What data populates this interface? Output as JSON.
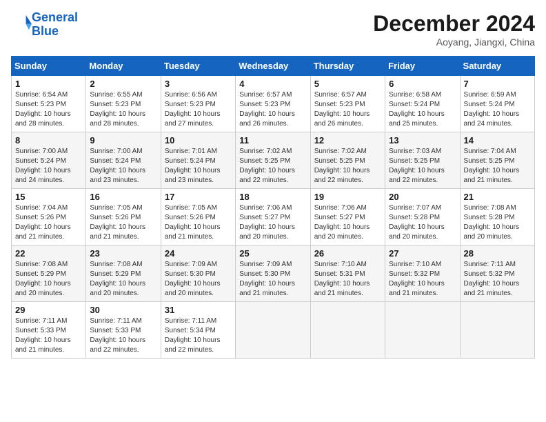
{
  "header": {
    "logo_line1": "General",
    "logo_line2": "Blue",
    "month_title": "December 2024",
    "location": "Aoyang, Jiangxi, China"
  },
  "weekdays": [
    "Sunday",
    "Monday",
    "Tuesday",
    "Wednesday",
    "Thursday",
    "Friday",
    "Saturday"
  ],
  "weeks": [
    [
      {
        "day": "1",
        "info": "Sunrise: 6:54 AM\nSunset: 5:23 PM\nDaylight: 10 hours\nand 28 minutes."
      },
      {
        "day": "2",
        "info": "Sunrise: 6:55 AM\nSunset: 5:23 PM\nDaylight: 10 hours\nand 28 minutes."
      },
      {
        "day": "3",
        "info": "Sunrise: 6:56 AM\nSunset: 5:23 PM\nDaylight: 10 hours\nand 27 minutes."
      },
      {
        "day": "4",
        "info": "Sunrise: 6:57 AM\nSunset: 5:23 PM\nDaylight: 10 hours\nand 26 minutes."
      },
      {
        "day": "5",
        "info": "Sunrise: 6:57 AM\nSunset: 5:23 PM\nDaylight: 10 hours\nand 26 minutes."
      },
      {
        "day": "6",
        "info": "Sunrise: 6:58 AM\nSunset: 5:24 PM\nDaylight: 10 hours\nand 25 minutes."
      },
      {
        "day": "7",
        "info": "Sunrise: 6:59 AM\nSunset: 5:24 PM\nDaylight: 10 hours\nand 24 minutes."
      }
    ],
    [
      {
        "day": "8",
        "info": "Sunrise: 7:00 AM\nSunset: 5:24 PM\nDaylight: 10 hours\nand 24 minutes."
      },
      {
        "day": "9",
        "info": "Sunrise: 7:00 AM\nSunset: 5:24 PM\nDaylight: 10 hours\nand 23 minutes."
      },
      {
        "day": "10",
        "info": "Sunrise: 7:01 AM\nSunset: 5:24 PM\nDaylight: 10 hours\nand 23 minutes."
      },
      {
        "day": "11",
        "info": "Sunrise: 7:02 AM\nSunset: 5:25 PM\nDaylight: 10 hours\nand 22 minutes."
      },
      {
        "day": "12",
        "info": "Sunrise: 7:02 AM\nSunset: 5:25 PM\nDaylight: 10 hours\nand 22 minutes."
      },
      {
        "day": "13",
        "info": "Sunrise: 7:03 AM\nSunset: 5:25 PM\nDaylight: 10 hours\nand 22 minutes."
      },
      {
        "day": "14",
        "info": "Sunrise: 7:04 AM\nSunset: 5:25 PM\nDaylight: 10 hours\nand 21 minutes."
      }
    ],
    [
      {
        "day": "15",
        "info": "Sunrise: 7:04 AM\nSunset: 5:26 PM\nDaylight: 10 hours\nand 21 minutes."
      },
      {
        "day": "16",
        "info": "Sunrise: 7:05 AM\nSunset: 5:26 PM\nDaylight: 10 hours\nand 21 minutes."
      },
      {
        "day": "17",
        "info": "Sunrise: 7:05 AM\nSunset: 5:26 PM\nDaylight: 10 hours\nand 21 minutes."
      },
      {
        "day": "18",
        "info": "Sunrise: 7:06 AM\nSunset: 5:27 PM\nDaylight: 10 hours\nand 20 minutes."
      },
      {
        "day": "19",
        "info": "Sunrise: 7:06 AM\nSunset: 5:27 PM\nDaylight: 10 hours\nand 20 minutes."
      },
      {
        "day": "20",
        "info": "Sunrise: 7:07 AM\nSunset: 5:28 PM\nDaylight: 10 hours\nand 20 minutes."
      },
      {
        "day": "21",
        "info": "Sunrise: 7:08 AM\nSunset: 5:28 PM\nDaylight: 10 hours\nand 20 minutes."
      }
    ],
    [
      {
        "day": "22",
        "info": "Sunrise: 7:08 AM\nSunset: 5:29 PM\nDaylight: 10 hours\nand 20 minutes."
      },
      {
        "day": "23",
        "info": "Sunrise: 7:08 AM\nSunset: 5:29 PM\nDaylight: 10 hours\nand 20 minutes."
      },
      {
        "day": "24",
        "info": "Sunrise: 7:09 AM\nSunset: 5:30 PM\nDaylight: 10 hours\nand 20 minutes."
      },
      {
        "day": "25",
        "info": "Sunrise: 7:09 AM\nSunset: 5:30 PM\nDaylight: 10 hours\nand 21 minutes."
      },
      {
        "day": "26",
        "info": "Sunrise: 7:10 AM\nSunset: 5:31 PM\nDaylight: 10 hours\nand 21 minutes."
      },
      {
        "day": "27",
        "info": "Sunrise: 7:10 AM\nSunset: 5:32 PM\nDaylight: 10 hours\nand 21 minutes."
      },
      {
        "day": "28",
        "info": "Sunrise: 7:11 AM\nSunset: 5:32 PM\nDaylight: 10 hours\nand 21 minutes."
      }
    ],
    [
      {
        "day": "29",
        "info": "Sunrise: 7:11 AM\nSunset: 5:33 PM\nDaylight: 10 hours\nand 21 minutes."
      },
      {
        "day": "30",
        "info": "Sunrise: 7:11 AM\nSunset: 5:33 PM\nDaylight: 10 hours\nand 22 minutes."
      },
      {
        "day": "31",
        "info": "Sunrise: 7:11 AM\nSunset: 5:34 PM\nDaylight: 10 hours\nand 22 minutes."
      },
      null,
      null,
      null,
      null
    ]
  ]
}
